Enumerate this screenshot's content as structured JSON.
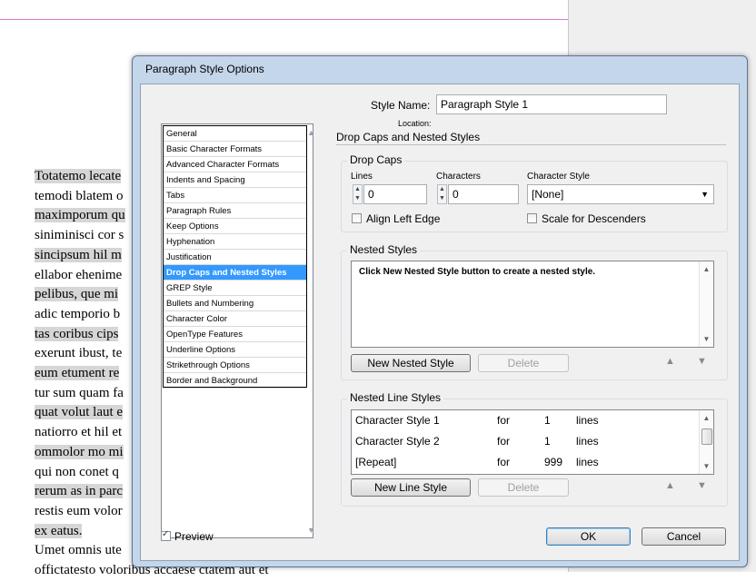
{
  "document": {
    "lines": [
      {
        "text": "Totatemo lecate",
        "hl": true
      },
      {
        "text": "temodi blatem o",
        "hl": false
      },
      {
        "text": "maximporum qu",
        "hl": true
      },
      {
        "text": "siniminisci cor s",
        "hl": false
      },
      {
        "text": "sincipsum hil m",
        "hl": true
      },
      {
        "text": "ellabor ehenime",
        "hl": false
      },
      {
        "text": "pelibus, que mi",
        "hl": true
      },
      {
        "text": "adic temporio b",
        "hl": false
      },
      {
        "text": "tas coribus cips",
        "hl": true
      },
      {
        "text": "exerunt ibust, te",
        "hl": false
      },
      {
        "text": "eum etument re",
        "hl": true
      },
      {
        "text": "tur sum quam fa",
        "hl": false
      },
      {
        "text": "quat volut laut e",
        "hl": true
      },
      {
        "text": "natiorro et hil et",
        "hl": false
      },
      {
        "text": "ommolor mo mi",
        "hl": true
      },
      {
        "text": "qui non conet q",
        "hl": false
      },
      {
        "text": "rerum as in parc",
        "hl": true
      },
      {
        "text": "restis eum volor",
        "hl": false
      },
      {
        "text": "ex eatus.",
        "hl": true
      },
      {
        "text": "Umet omnis ute",
        "hl": false
      },
      {
        "text": "offictatesto voloribus accaese ctatem aut et",
        "hl": false
      }
    ]
  },
  "dialog": {
    "title": "Paragraph Style Options",
    "categories": [
      "General",
      "Basic Character Formats",
      "Advanced Character Formats",
      "Indents and Spacing",
      "Tabs",
      "Paragraph Rules",
      "Keep Options",
      "Hyphenation",
      "Justification",
      "Drop Caps and Nested Styles",
      "GREP Style",
      "Bullets and Numbering",
      "Character Color",
      "OpenType Features",
      "Underline Options",
      "Strikethrough Options",
      "Border and Background"
    ],
    "selected_category": "Drop Caps and Nested Styles",
    "style_name_label": "Style Name:",
    "style_name_value": "Paragraph Style 1",
    "location_label": "Location:",
    "section_title": "Drop Caps and Nested Styles",
    "drop_caps": {
      "title": "Drop Caps",
      "lines_label": "Lines",
      "lines_value": "0",
      "characters_label": "Characters",
      "characters_value": "0",
      "char_style_label": "Character Style",
      "char_style_value": "[None]",
      "align_left_edge": "Align Left Edge",
      "scale_descenders": "Scale for Descenders"
    },
    "nested_styles": {
      "title": "Nested Styles",
      "hint": "Click New Nested Style button to create a nested style.",
      "new_button": "New Nested Style",
      "delete_button": "Delete"
    },
    "nested_line_styles": {
      "title": "Nested Line Styles",
      "rows": [
        {
          "style": "Character Style 1",
          "for": "for",
          "count": "1",
          "unit": "lines"
        },
        {
          "style": "Character Style 2",
          "for": "for",
          "count": "1",
          "unit": "lines"
        },
        {
          "style": "[Repeat]",
          "for": "for",
          "count": "999",
          "unit": "lines"
        }
      ],
      "new_button": "New Line Style",
      "delete_button": "Delete"
    },
    "preview_label": "Preview",
    "preview_checked": true,
    "ok_button": "OK",
    "cancel_button": "Cancel"
  }
}
